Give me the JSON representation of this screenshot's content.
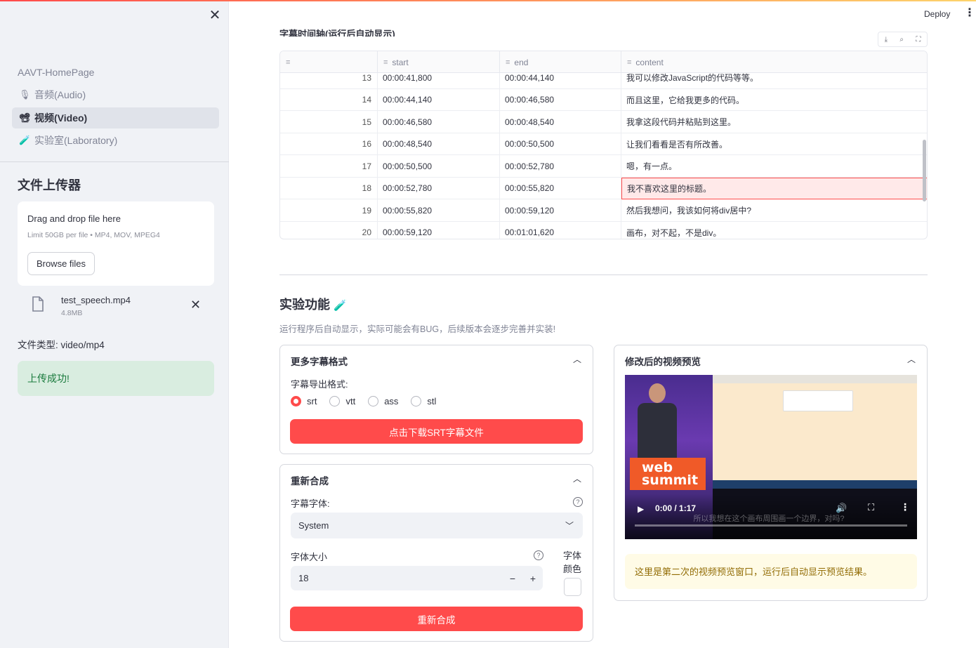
{
  "sidebar": {
    "close_icon": "close-icon",
    "nav_home": "AAVT-HomePage",
    "nav_items": [
      {
        "icon": "microphone-icon",
        "label": "音频(Audio)",
        "active": false
      },
      {
        "icon": "film-camera-icon",
        "label": "视频(Video)",
        "active": true
      },
      {
        "icon": "test-tube-icon",
        "label": "实验室(Laboratory)",
        "active": false
      }
    ],
    "uploader_heading": "文件上传器",
    "uploader": {
      "drop_text": "Drag and drop file here",
      "limit_text": "Limit 50GB per file • MP4, MOV, MPEG4",
      "browse_label": "Browse files"
    },
    "file": {
      "name": "test_speech.mp4",
      "size": "4.8MB"
    },
    "file_type": "文件类型: video/mp4",
    "success_message": "上传成功!"
  },
  "header": {
    "deploy_label": "Deploy"
  },
  "timeline": {
    "title": "字幕时间轴(运行后自动显示)",
    "columns": [
      "",
      "start",
      "end",
      "content"
    ],
    "rows": [
      {
        "idx": "13",
        "start": "00:00:41,800",
        "end": "00:00:44,140",
        "content": "我可以修改JavaScript的代码等等。"
      },
      {
        "idx": "14",
        "start": "00:00:44,140",
        "end": "00:00:46,580",
        "content": "而且这里，它给我更多的代码。"
      },
      {
        "idx": "15",
        "start": "00:00:46,580",
        "end": "00:00:48,540",
        "content": "我拿这段代码并粘贴到这里。"
      },
      {
        "idx": "16",
        "start": "00:00:48,540",
        "end": "00:00:50,500",
        "content": "让我们看看是否有所改善。"
      },
      {
        "idx": "17",
        "start": "00:00:50,500",
        "end": "00:00:52,780",
        "content": "嗯，有一点。"
      },
      {
        "idx": "18",
        "start": "00:00:52,780",
        "end": "00:00:55,820",
        "content": "我不喜欢这里的标题。"
      },
      {
        "idx": "19",
        "start": "00:00:55,820",
        "end": "00:00:59,120",
        "content": "然后我想问，我该如何将div居中?"
      },
      {
        "idx": "20",
        "start": "00:00:59,120",
        "end": "00:01:01,620",
        "content": "画布，对不起，不是div。"
      }
    ],
    "selected_row_index": 5
  },
  "lab": {
    "title": "实验功能",
    "title_icon": "test-tube-icon",
    "subtitle": "运行程序后自动显示，实际可能会有BUG，后续版本会逐步完善并实装!",
    "formats_card": {
      "title": "更多字幕格式",
      "label": "字幕导出格式:",
      "options": [
        "srt",
        "vtt",
        "ass",
        "stl"
      ],
      "selected": "srt",
      "download_label": "点击下载SRT字幕文件"
    },
    "resynth_card": {
      "title": "重新合成",
      "font_label": "字幕字体:",
      "font_value": "System",
      "size_label": "字体大小",
      "size_value": "18",
      "color_label": "字体颜色",
      "button_label": "重新合成"
    },
    "preview_card": {
      "title": "修改后的视频预览",
      "time": "0:00 / 1:17",
      "logo_text": "web summit",
      "subtitle_overlay": "所以我想在这个画布周围画一个边界，对吗?",
      "progress": 0,
      "info": "这里是第二次的视频预览窗口，运行后自动显示预览结果。"
    }
  }
}
